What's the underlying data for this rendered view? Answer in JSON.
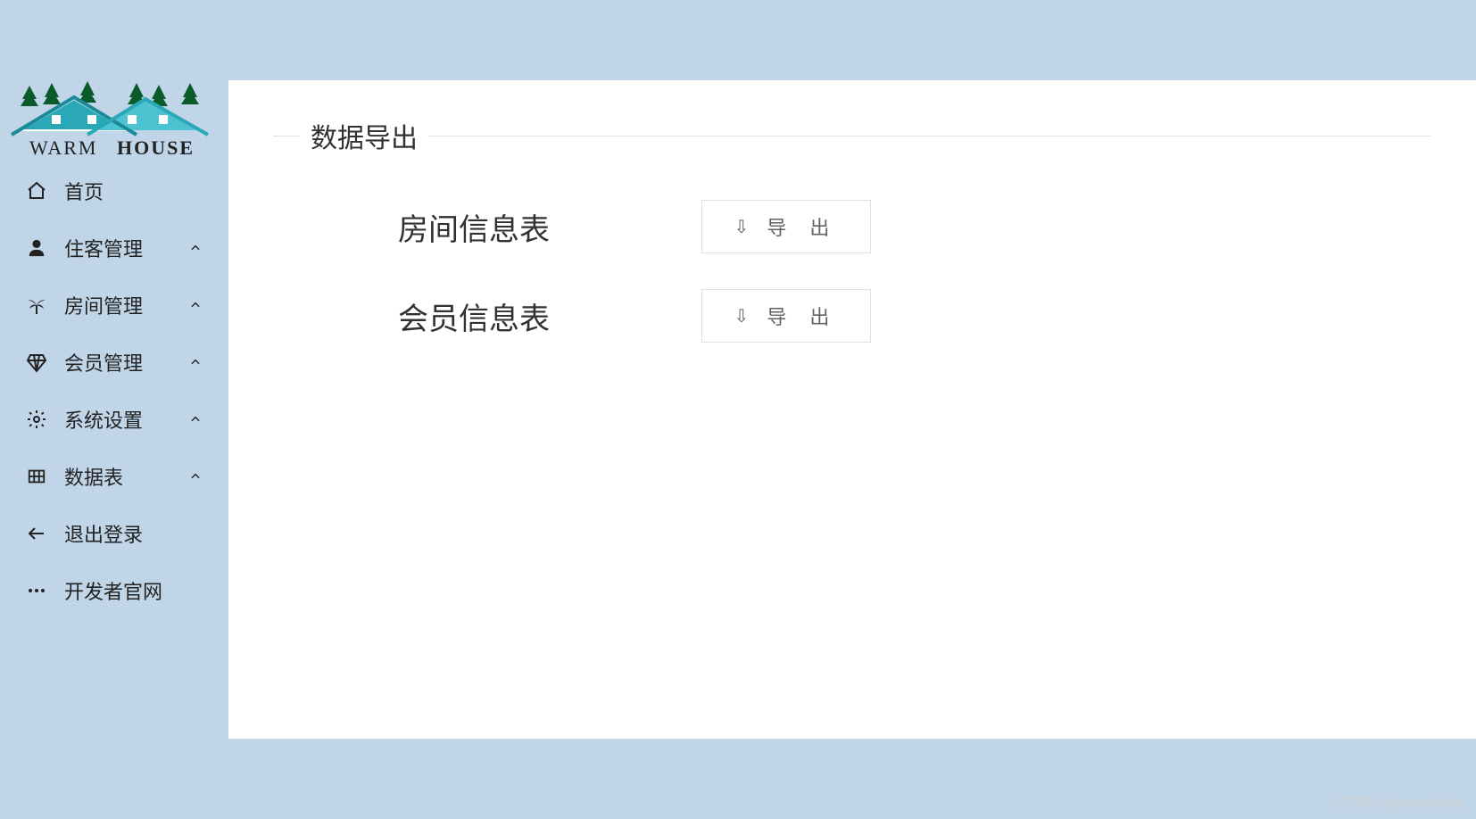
{
  "brand": {
    "line1": "WARM",
    "line2": "HOUSE"
  },
  "sidebar": {
    "items": [
      {
        "label": "首页",
        "icon": "home-icon",
        "expandable": false
      },
      {
        "label": "住客管理",
        "icon": "person-icon",
        "expandable": true
      },
      {
        "label": "房间管理",
        "icon": "palm-icon",
        "expandable": true
      },
      {
        "label": "会员管理",
        "icon": "diamond-icon",
        "expandable": true
      },
      {
        "label": "系统设置",
        "icon": "gear-icon",
        "expandable": true
      },
      {
        "label": "数据表",
        "icon": "grid-icon",
        "expandable": true
      },
      {
        "label": "退出登录",
        "icon": "arrow-left-icon",
        "expandable": false
      },
      {
        "label": "开发者官网",
        "icon": "dots-icon",
        "expandable": false
      }
    ]
  },
  "main": {
    "section_title": "数据导出",
    "rows": [
      {
        "label": "房间信息表",
        "button": "导 出"
      },
      {
        "label": "会员信息表",
        "button": "导 出"
      }
    ]
  },
  "watermark": "CSDN @pastclouds"
}
